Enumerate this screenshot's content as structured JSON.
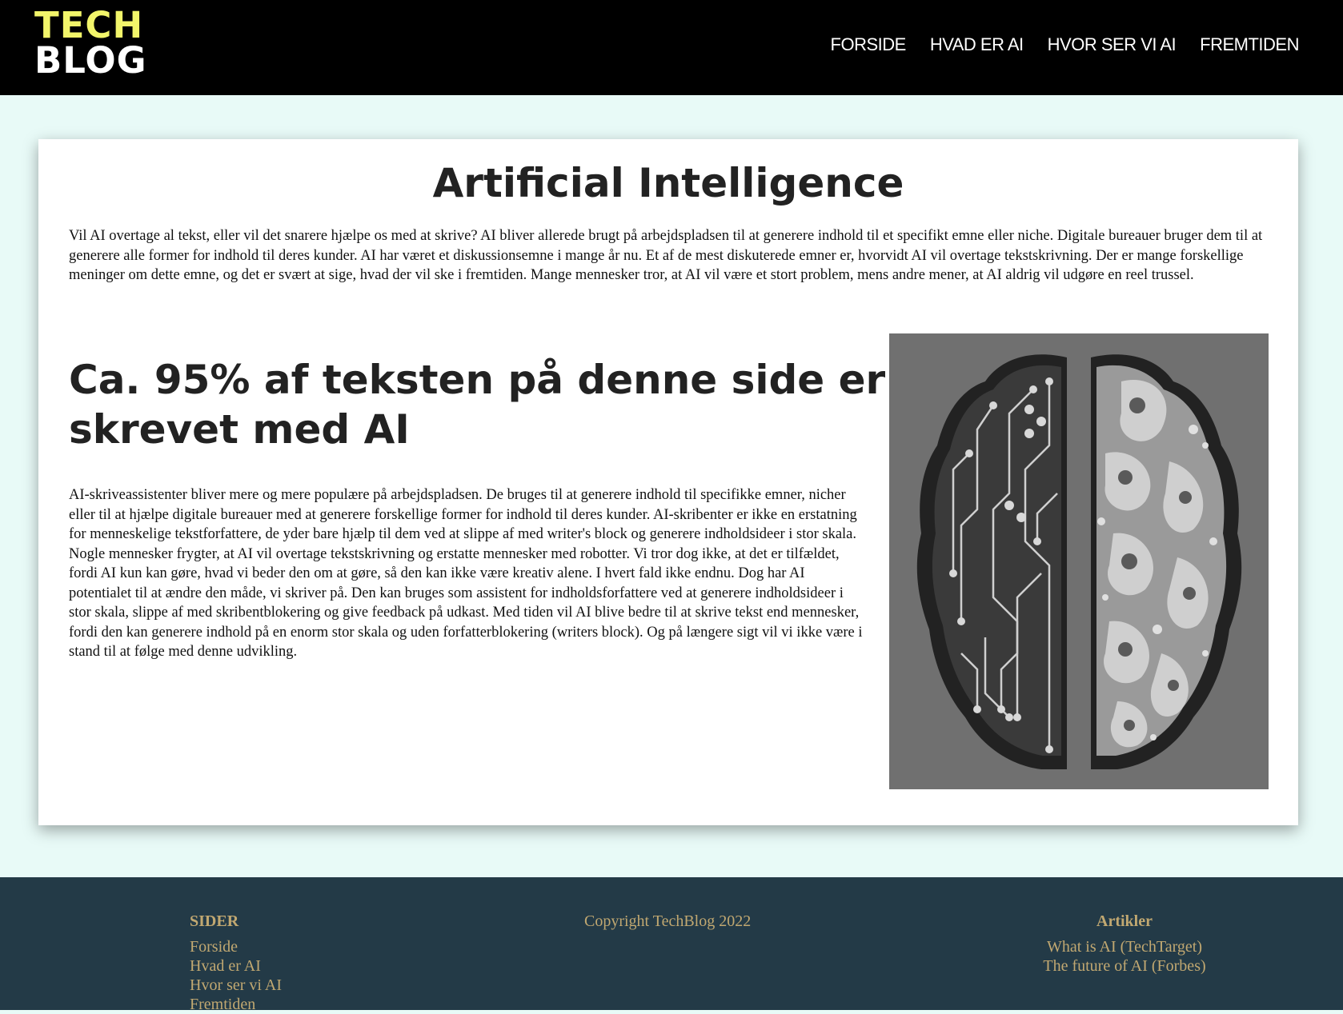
{
  "header": {
    "logo_line1": "TECH",
    "logo_line2": "BLOG",
    "nav": [
      "FORSIDE",
      "HVAD ER AI",
      "HVOR SER VI AI",
      "FREMTIDEN"
    ]
  },
  "main": {
    "title": "Artificial Intelligence",
    "intro": "Vil AI overtage al tekst, eller vil det snarere hjælpe os med at skrive? AI bliver allerede brugt på arbejdspladsen til at generere indhold til et specifikt emne eller niche. Digitale bureauer bruger dem til at generere alle former for indhold til deres kunder. AI har været et diskussionsemne i mange år nu. Et af de mest diskuterede emner er, hvorvidt AI vil overtage tekstskrivning. Der er mange forskellige meninger om dette emne, og det er svært at sige, hvad der vil ske i fremtiden. Mange mennesker tror, at AI vil være et stort problem, mens andre mener, at AI aldrig vil udgøre en reel trussel.",
    "subheading": "Ca. 95% af teksten på denne side er skrevet med AI",
    "body": "AI-skriveassistenter bliver mere og mere populære på arbejdspladsen. De bruges til at generere indhold til specifikke emner, nicher eller til at hjælpe digitale bureauer med at generere forskellige former for indhold til deres kunder. AI-skribenter er ikke en erstatning for menneskelige tekstforfattere, de yder bare hjælp til dem ved at slippe af med writer's block og generere indholdsideer i stor skala. Nogle mennesker frygter, at AI vil overtage tekstskrivning og erstatte mennesker med robotter. Vi tror dog ikke, at det er tilfældet, fordi AI kun kan gøre, hvad vi beder den om at gøre, så den kan ikke være kreativ alene. I hvert fald ikke endnu. Dog har AI potentialet til at ændre den måde, vi skriver på. Den kan bruges som assistent for indholdsforfattere ved at generere indholdsideer i stor skala, slippe af med skribentblokering og give feedback på udkast. Med tiden vil AI blive bedre til at skrive tekst end mennesker, fordi den kan generere indhold på en enorm stor skala og uden forfatterblokering (writers block). Og på længere sigt vil vi ikke være i stand til at følge med denne udvikling."
  },
  "footer": {
    "pages_heading": "SIDER",
    "pages": [
      "Forside",
      "Hvad er AI",
      "Hvor ser vi AI",
      "Fremtiden"
    ],
    "copyright": "Copyright TechBlog 2022",
    "articles_heading": "Artikler",
    "articles": [
      "What is AI (TechTarget)",
      "The future of AI (Forbes)"
    ]
  },
  "colors": {
    "header_bg": "#000000",
    "logo_accent": "#f2f56a",
    "page_bg": "#e8faf7",
    "footer_bg": "#233a47",
    "footer_text": "#c1a871"
  }
}
